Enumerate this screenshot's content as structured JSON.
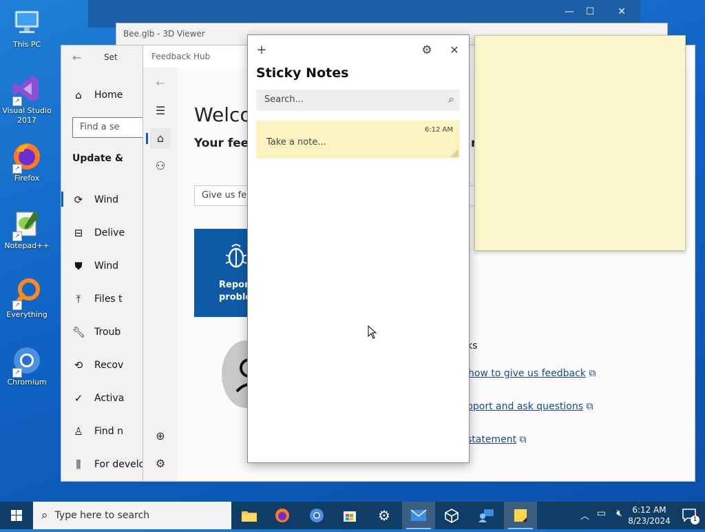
{
  "desktop": {
    "icons": [
      {
        "label": "This PC",
        "icon": "computer-icon"
      },
      {
        "label": "Visual Studio 2017",
        "icon": "visual-studio-icon"
      },
      {
        "label": "Firefox",
        "icon": "firefox-icon"
      },
      {
        "label": "Notepad++",
        "icon": "notepadpp-icon"
      },
      {
        "label": "Everything",
        "icon": "search-everything-icon"
      },
      {
        "label": "Chromium",
        "icon": "chromium-icon"
      }
    ]
  },
  "viewer3d": {
    "title": "Bee.glb - 3D Viewer"
  },
  "settings": {
    "title": "Set",
    "home": "Home",
    "search_placeholder": "Find a se",
    "section": "Update &",
    "items": [
      {
        "label": "Wind",
        "icon": "refresh-icon"
      },
      {
        "label": "Delive",
        "icon": "delivery-icon"
      },
      {
        "label": "Wind",
        "icon": "shield-icon"
      },
      {
        "label": "Files t",
        "icon": "upload-icon"
      },
      {
        "label": "Troub",
        "icon": "wrench-icon"
      },
      {
        "label": "Recov",
        "icon": "recovery-icon"
      },
      {
        "label": "Activa",
        "icon": "check-circle-icon"
      },
      {
        "label": "Find n",
        "icon": "person-icon"
      },
      {
        "label": "For develop",
        "icon": "developer-icon"
      }
    ]
  },
  "feedback": {
    "title": "Feedback Hub",
    "welcome": "Welcor",
    "subtitle": "Your feed",
    "give_feedback": "Give us fee",
    "report_line1": "Report",
    "report_line2": "proble",
    "subtitle_tail": "n",
    "links_heading_tail": "ks",
    "links": [
      "how to give us feedback",
      "pport and ask questions",
      "statement"
    ]
  },
  "sticky": {
    "title": "Sticky Notes",
    "search_placeholder": "Search...",
    "note_time": "6:12 AM",
    "note_placeholder": "Take a note...",
    "colors": {
      "note": "#fcf3c0",
      "window_note": "#fdf7cf"
    }
  },
  "taskbar": {
    "search_placeholder": "Type here to search",
    "apps": [
      "file-explorer-icon",
      "firefox-icon",
      "chromium-icon",
      "store-icon",
      "settings-icon",
      "mail-icon",
      "3d-viewer-icon",
      "feedback-hub-icon",
      "sticky-notes-icon"
    ],
    "time": "6:12 AM",
    "date": "8/23/2024",
    "notification_count": "1"
  }
}
